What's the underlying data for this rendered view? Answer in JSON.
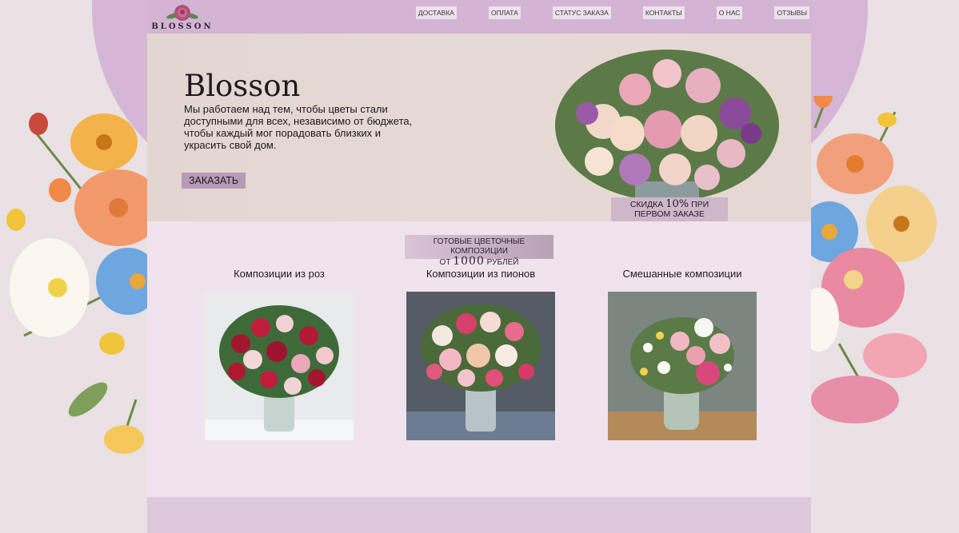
{
  "header": {
    "logo_text": "BLOSSON",
    "nav": [
      "ДОСТАВКА",
      "ОПЛАТА",
      "СТАТУС ЗАКАЗА",
      "КОНТАКТЫ",
      "О НАС",
      "ОТЗЫВЫ"
    ]
  },
  "hero": {
    "title": "Blosson",
    "text": "Мы работаем над тем, чтобы цветы стали доступными для всех, независимо от бюджета, чтобы каждый мог порадовать близких и украсить свой дом.",
    "order_button": "ЗАКАЗАТЬ",
    "discount_line1_pre": "СКИДКА",
    "discount_value": "10%",
    "discount_line1_post": "ПРИ",
    "discount_line2": "ПЕРВОМ ЗАКАЗЕ"
  },
  "products": {
    "promo_line1": "ГОТОВЫЕ ЦВЕТОЧНЫЕ КОМПОЗИЦИИ",
    "promo_pre": "ОТ",
    "promo_value": "1000",
    "promo_post": "РУБЛЕЙ",
    "categories": [
      {
        "title": "Композиции из роз"
      },
      {
        "title": "Композиции из пионов"
      },
      {
        "title": "Смешанные композиции"
      }
    ]
  },
  "colors": {
    "header_bg": "#d4b4d4",
    "accent_button": "#b79bb6",
    "products_bg": "#f1e3ee",
    "page_bg": "#e9e1e3"
  }
}
